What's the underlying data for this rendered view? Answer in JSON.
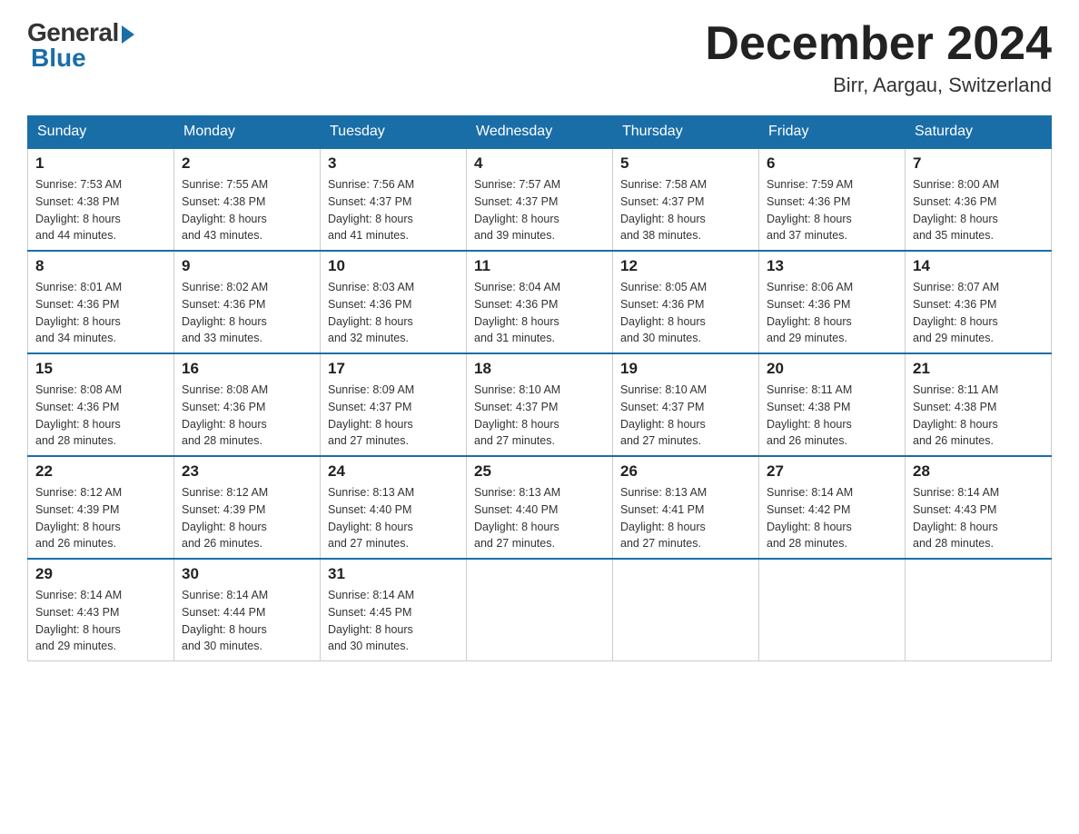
{
  "header": {
    "logo_general": "General",
    "logo_blue": "Blue",
    "month_title": "December 2024",
    "location": "Birr, Aargau, Switzerland"
  },
  "weekdays": [
    "Sunday",
    "Monday",
    "Tuesday",
    "Wednesday",
    "Thursday",
    "Friday",
    "Saturday"
  ],
  "weeks": [
    [
      {
        "day": "1",
        "sunrise": "7:53 AM",
        "sunset": "4:38 PM",
        "daylight": "8 hours and 44 minutes."
      },
      {
        "day": "2",
        "sunrise": "7:55 AM",
        "sunset": "4:38 PM",
        "daylight": "8 hours and 43 minutes."
      },
      {
        "day": "3",
        "sunrise": "7:56 AM",
        "sunset": "4:37 PM",
        "daylight": "8 hours and 41 minutes."
      },
      {
        "day": "4",
        "sunrise": "7:57 AM",
        "sunset": "4:37 PM",
        "daylight": "8 hours and 39 minutes."
      },
      {
        "day": "5",
        "sunrise": "7:58 AM",
        "sunset": "4:37 PM",
        "daylight": "8 hours and 38 minutes."
      },
      {
        "day": "6",
        "sunrise": "7:59 AM",
        "sunset": "4:36 PM",
        "daylight": "8 hours and 37 minutes."
      },
      {
        "day": "7",
        "sunrise": "8:00 AM",
        "sunset": "4:36 PM",
        "daylight": "8 hours and 35 minutes."
      }
    ],
    [
      {
        "day": "8",
        "sunrise": "8:01 AM",
        "sunset": "4:36 PM",
        "daylight": "8 hours and 34 minutes."
      },
      {
        "day": "9",
        "sunrise": "8:02 AM",
        "sunset": "4:36 PM",
        "daylight": "8 hours and 33 minutes."
      },
      {
        "day": "10",
        "sunrise": "8:03 AM",
        "sunset": "4:36 PM",
        "daylight": "8 hours and 32 minutes."
      },
      {
        "day": "11",
        "sunrise": "8:04 AM",
        "sunset": "4:36 PM",
        "daylight": "8 hours and 31 minutes."
      },
      {
        "day": "12",
        "sunrise": "8:05 AM",
        "sunset": "4:36 PM",
        "daylight": "8 hours and 30 minutes."
      },
      {
        "day": "13",
        "sunrise": "8:06 AM",
        "sunset": "4:36 PM",
        "daylight": "8 hours and 29 minutes."
      },
      {
        "day": "14",
        "sunrise": "8:07 AM",
        "sunset": "4:36 PM",
        "daylight": "8 hours and 29 minutes."
      }
    ],
    [
      {
        "day": "15",
        "sunrise": "8:08 AM",
        "sunset": "4:36 PM",
        "daylight": "8 hours and 28 minutes."
      },
      {
        "day": "16",
        "sunrise": "8:08 AM",
        "sunset": "4:36 PM",
        "daylight": "8 hours and 28 minutes."
      },
      {
        "day": "17",
        "sunrise": "8:09 AM",
        "sunset": "4:37 PM",
        "daylight": "8 hours and 27 minutes."
      },
      {
        "day": "18",
        "sunrise": "8:10 AM",
        "sunset": "4:37 PM",
        "daylight": "8 hours and 27 minutes."
      },
      {
        "day": "19",
        "sunrise": "8:10 AM",
        "sunset": "4:37 PM",
        "daylight": "8 hours and 27 minutes."
      },
      {
        "day": "20",
        "sunrise": "8:11 AM",
        "sunset": "4:38 PM",
        "daylight": "8 hours and 26 minutes."
      },
      {
        "day": "21",
        "sunrise": "8:11 AM",
        "sunset": "4:38 PM",
        "daylight": "8 hours and 26 minutes."
      }
    ],
    [
      {
        "day": "22",
        "sunrise": "8:12 AM",
        "sunset": "4:39 PM",
        "daylight": "8 hours and 26 minutes."
      },
      {
        "day": "23",
        "sunrise": "8:12 AM",
        "sunset": "4:39 PM",
        "daylight": "8 hours and 26 minutes."
      },
      {
        "day": "24",
        "sunrise": "8:13 AM",
        "sunset": "4:40 PM",
        "daylight": "8 hours and 27 minutes."
      },
      {
        "day": "25",
        "sunrise": "8:13 AM",
        "sunset": "4:40 PM",
        "daylight": "8 hours and 27 minutes."
      },
      {
        "day": "26",
        "sunrise": "8:13 AM",
        "sunset": "4:41 PM",
        "daylight": "8 hours and 27 minutes."
      },
      {
        "day": "27",
        "sunrise": "8:14 AM",
        "sunset": "4:42 PM",
        "daylight": "8 hours and 28 minutes."
      },
      {
        "day": "28",
        "sunrise": "8:14 AM",
        "sunset": "4:43 PM",
        "daylight": "8 hours and 28 minutes."
      }
    ],
    [
      {
        "day": "29",
        "sunrise": "8:14 AM",
        "sunset": "4:43 PM",
        "daylight": "8 hours and 29 minutes."
      },
      {
        "day": "30",
        "sunrise": "8:14 AM",
        "sunset": "4:44 PM",
        "daylight": "8 hours and 30 minutes."
      },
      {
        "day": "31",
        "sunrise": "8:14 AM",
        "sunset": "4:45 PM",
        "daylight": "8 hours and 30 minutes."
      },
      null,
      null,
      null,
      null
    ]
  ],
  "labels": {
    "sunrise": "Sunrise:",
    "sunset": "Sunset:",
    "daylight": "Daylight:"
  }
}
